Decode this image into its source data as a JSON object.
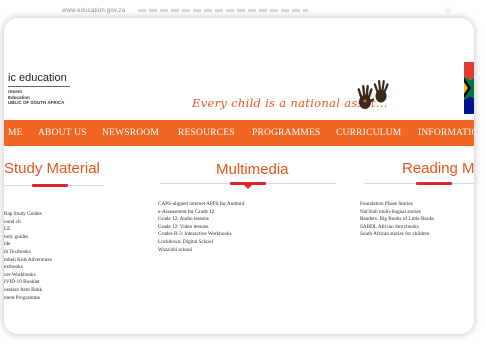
{
  "browser": {
    "url": "www.education.gov.za"
  },
  "header": {
    "site_title": "ic education",
    "dept_lines": [
      "rtment",
      "Education",
      "UBLIC OF SOUTH AFRICA"
    ],
    "tagline": "Every child is a national asset..."
  },
  "nav": [
    "ME",
    "ABOUT US",
    "NEWSROOM",
    "RESOURCES",
    "PROGRAMMES",
    "CURRICULUM",
    "INFORMATION"
  ],
  "columns": {
    "study": {
      "title": "Study Material",
      "items": [
        "Rap Study Guides",
        "ound cb",
        "LE",
        "tudy guides",
        "ide",
        "ib Textbooks",
        "mbeli Kids Adventures",
        "extbooks",
        "ure Workbooks",
        "IVID-19 Booklet",
        "uestion Item Bank",
        "ment Programme"
      ]
    },
    "multimedia": {
      "title": "Multimedia",
      "items": [
        "CAPS-aligned internet APPS for Android",
        "e-Assessment for Grade 12",
        "Grade 12: Audio lessons",
        "Grade 12: Video lessons",
        "Grades R-3: Interactive Workbooks",
        "Lockdown: Digital School",
        "Woza'obi school"
      ]
    },
    "reading": {
      "title": "Reading Mate",
      "items": [
        "Foundation Phase Stories",
        "Nal'ibali multi-lingual stories",
        "Readers: Big Books of Little Books",
        "SABDL African Storybooks",
        "South African stories for children"
      ]
    }
  },
  "colors": {
    "accent": "#f26522",
    "title": "#e8541a",
    "bar": "#e0262b"
  },
  "icons": [
    "star-icon",
    "hands-logo-icon",
    "flag-icon"
  ]
}
